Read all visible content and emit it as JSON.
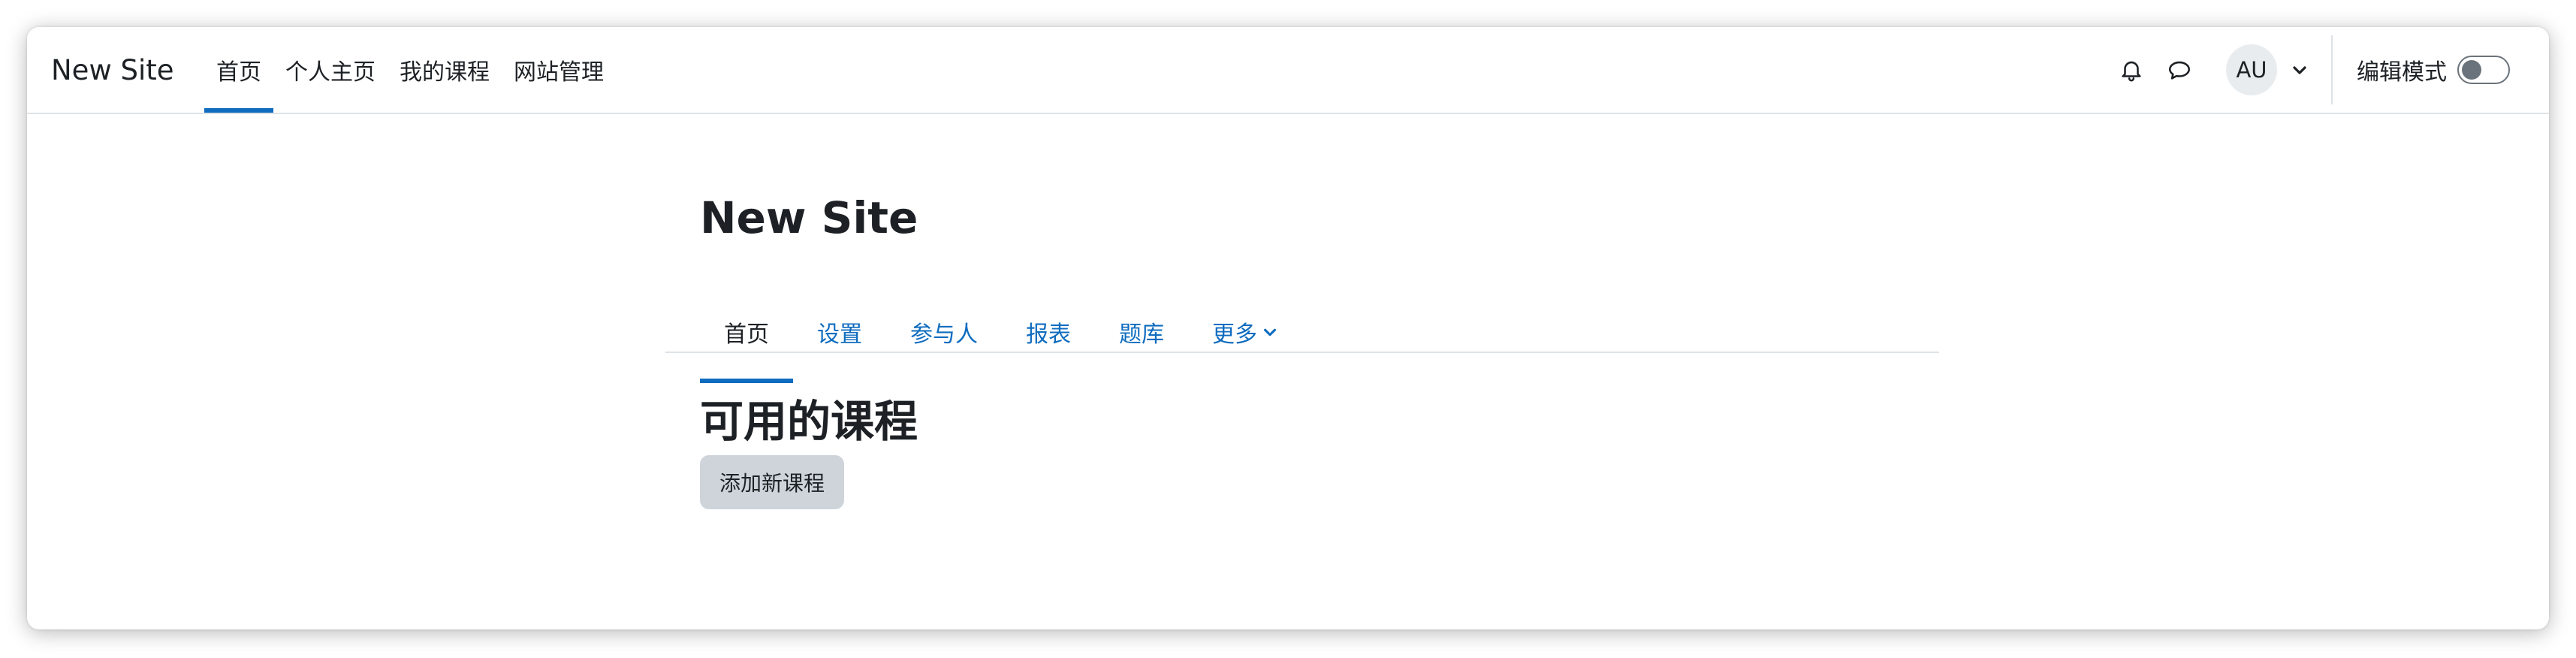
{
  "navbar": {
    "brand": "New Site",
    "items": [
      {
        "label": "首页",
        "active": true
      },
      {
        "label": "个人主页",
        "active": false
      },
      {
        "label": "我的课程",
        "active": false
      },
      {
        "label": "网站管理",
        "active": false
      }
    ],
    "icons": {
      "notifications": "bell-icon",
      "messages": "chat-bubble-icon",
      "user_menu": "chevron-down-icon"
    },
    "avatar_initials": "AU",
    "edit_mode_label": "编辑模式",
    "edit_mode_on": false
  },
  "page": {
    "title": "New Site",
    "secondary_nav": [
      {
        "label": "首页",
        "active": true
      },
      {
        "label": "设置",
        "active": false
      },
      {
        "label": "参与人",
        "active": false
      },
      {
        "label": "报表",
        "active": false
      },
      {
        "label": "题库",
        "active": false
      },
      {
        "label": "更多",
        "active": false,
        "has_dropdown": true
      }
    ],
    "section_heading": "可用的课程",
    "add_course_button": "添加新课程"
  },
  "colors": {
    "accent": "#0f6cbf",
    "text": "#1d2125",
    "border": "#dee2e6",
    "button_secondary": "#ced4da"
  }
}
